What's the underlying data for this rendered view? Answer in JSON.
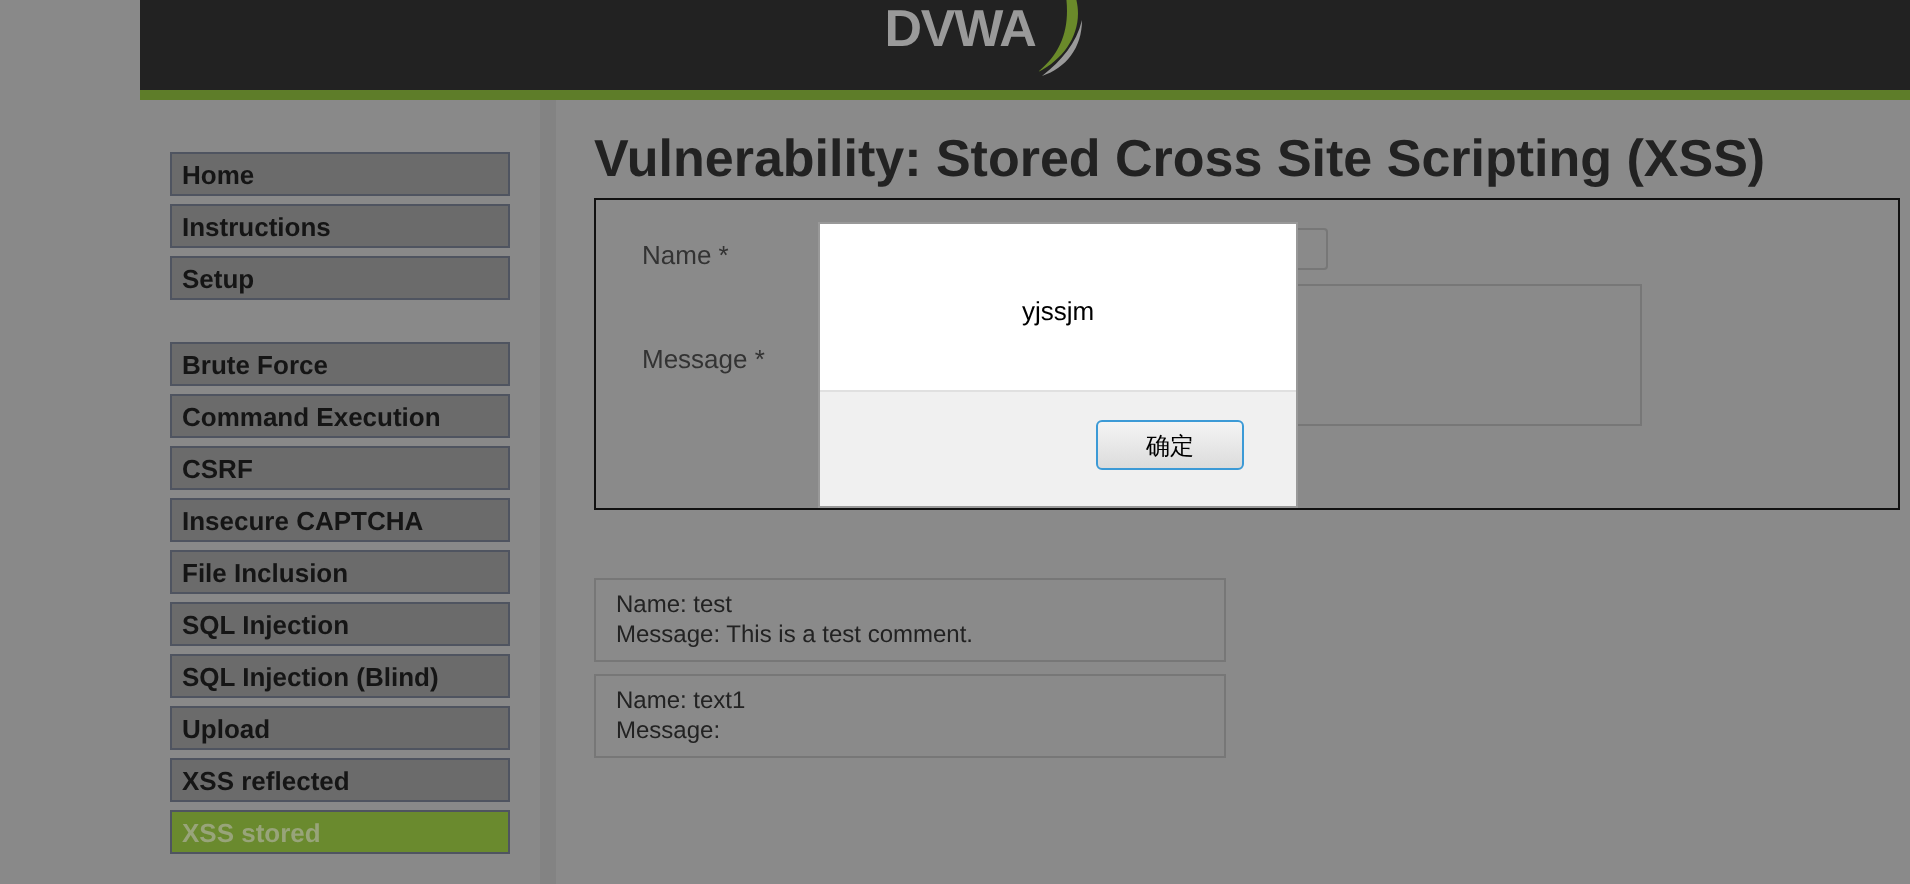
{
  "header": {
    "logo": "DVWA"
  },
  "sidebar": {
    "groups": [
      [
        {
          "label": "Home",
          "selected": false
        },
        {
          "label": "Instructions",
          "selected": false
        },
        {
          "label": "Setup",
          "selected": false
        }
      ],
      [
        {
          "label": "Brute Force",
          "selected": false
        },
        {
          "label": "Command Execution",
          "selected": false
        },
        {
          "label": "CSRF",
          "selected": false
        },
        {
          "label": "Insecure CAPTCHA",
          "selected": false
        },
        {
          "label": "File Inclusion",
          "selected": false
        },
        {
          "label": "SQL Injection",
          "selected": false
        },
        {
          "label": "SQL Injection (Blind)",
          "selected": false
        },
        {
          "label": "Upload",
          "selected": false
        },
        {
          "label": "XSS reflected",
          "selected": false
        },
        {
          "label": "XSS stored",
          "selected": true
        }
      ]
    ]
  },
  "main": {
    "title": "Vulnerability: Stored Cross Site Scripting (XSS)",
    "form": {
      "name_label": "Name *",
      "message_label": "Message *"
    },
    "comments": [
      {
        "name": "Name: test",
        "message": "Message: This is a test comment."
      },
      {
        "name": "Name: text1",
        "message": "Message:"
      }
    ]
  },
  "alert": {
    "message": "yjssjm",
    "button": "确定"
  }
}
